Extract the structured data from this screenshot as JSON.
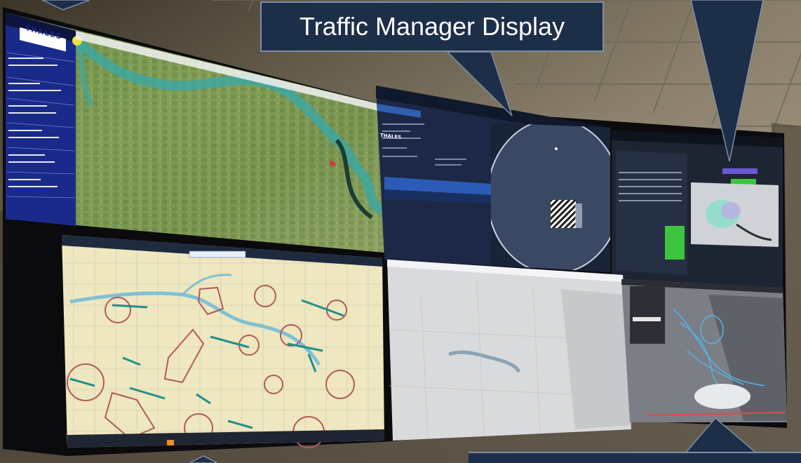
{
  "callout": {
    "text": "Traffic Manager Display"
  },
  "screen1": {
    "brand": "THALES",
    "status_items": [
      "Pending Approval",
      "Planned",
      "Pending Cancel"
    ]
  },
  "screen2": {
    "brand": "THALES"
  },
  "colors": {
    "callout_bg": "#1d2e48",
    "callout_border": "#7f8ea3",
    "sidebar_bg": "#1a2a8a",
    "button_green": "#3ec43e",
    "bezel": "#0b0b0d"
  },
  "icons": [
    "arrow-pointer",
    "filter-icon",
    "map-pin-icon"
  ]
}
